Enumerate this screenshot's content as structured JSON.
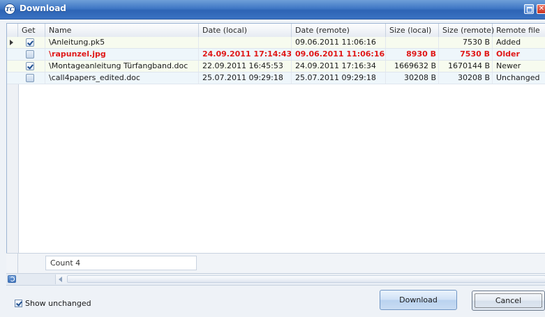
{
  "window": {
    "title": "Download",
    "logo_text": "TC",
    "close_glyph": "✕"
  },
  "columns": {
    "get": "Get",
    "name": "Name",
    "date_local": "Date (local)",
    "date_remote": "Date (remote)",
    "size_local": "Size (local)",
    "size_remote": "Size (remote)",
    "remote_file": "Remote file"
  },
  "rows": [
    {
      "checked": true,
      "current": true,
      "highlight": false,
      "name": "\\Anleitung.pk5",
      "date_local": "",
      "date_remote": "09.06.2011 11:06:16",
      "size_local": "",
      "size_remote": "7530 B",
      "remote_file": "Added"
    },
    {
      "checked": false,
      "current": false,
      "highlight": true,
      "name": "\\rapunzel.jpg",
      "date_local": "24.09.2011 17:14:43",
      "date_remote": "09.06.2011 11:06:16",
      "size_local": "8930 B",
      "size_remote": "7530 B",
      "remote_file": "Older"
    },
    {
      "checked": true,
      "current": false,
      "highlight": false,
      "name": "\\Montageanleitung Türfangband.doc",
      "date_local": "22.09.2011 16:45:53",
      "date_remote": "24.09.2011 17:16:34",
      "size_local": "1669632 B",
      "size_remote": "1670144 B",
      "remote_file": "Newer"
    },
    {
      "checked": false,
      "current": false,
      "highlight": false,
      "name": "\\call4papers_edited.doc",
      "date_local": "25.07.2011 09:29:18",
      "date_remote": "25.07.2011 09:29:18",
      "size_local": "30208 B",
      "size_remote": "30208 B",
      "remote_file": "Unchanged"
    }
  ],
  "summary": {
    "count": "Count 4"
  },
  "footer": {
    "show_unchanged_label": "Show unchanged",
    "show_unchanged_checked": true,
    "download_label": "Download",
    "cancel_label": "Cancel"
  },
  "colors": {
    "title_bar": "#3f77c5",
    "highlight_text": "#e01818",
    "row_alt_green": "#f7fbef",
    "row_alt_blue": "#eef6fb"
  },
  "icons": {
    "app": "tc-logo-icon",
    "maximize": "maximize-icon",
    "close": "close-icon",
    "current_row": "row-pointer-icon",
    "refresh": "refresh-icon",
    "scroll_left": "chevron-left-icon"
  }
}
